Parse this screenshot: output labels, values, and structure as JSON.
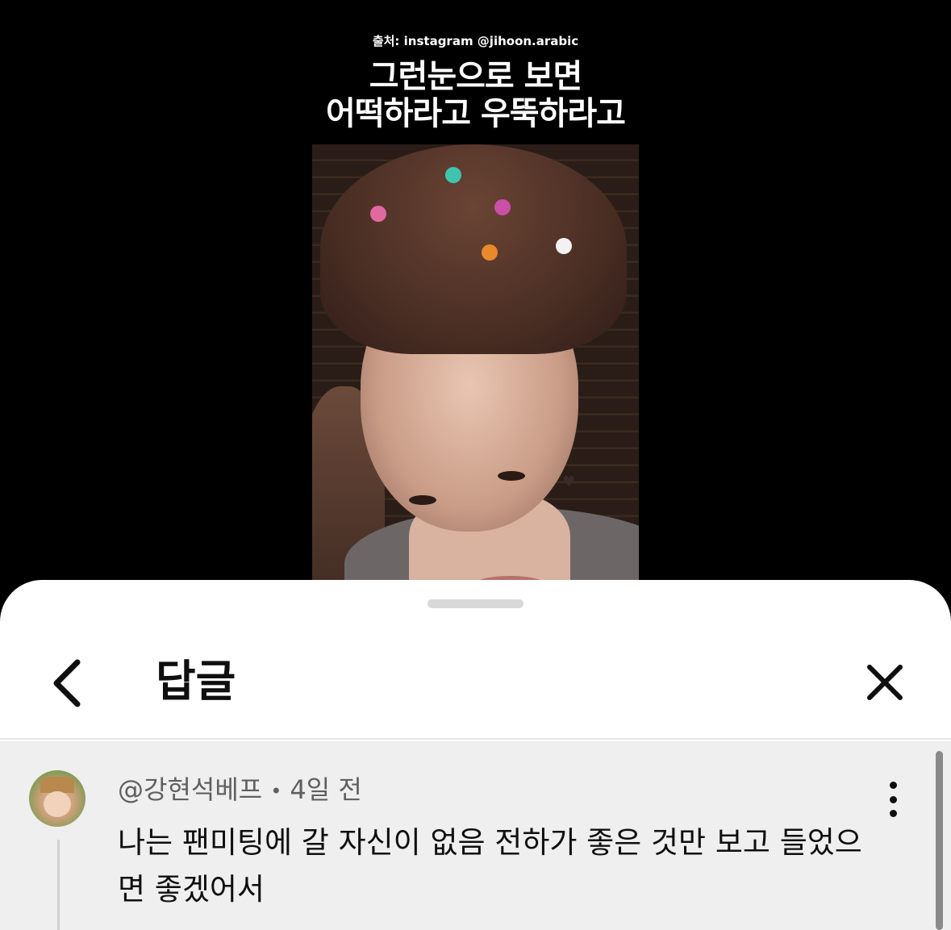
{
  "video": {
    "source_caption": "출처: instagram @jihoon.arabic",
    "title_line1": "그런눈으로 보면",
    "title_line2": "어떡하라고 우뚝하라고"
  },
  "sheet": {
    "title": "답글",
    "back_icon": "chevron-left-icon",
    "close_icon": "close-icon"
  },
  "comment": {
    "author": "@강현석베프",
    "separator": "•",
    "time": "4일 전",
    "text": "나는 팬미팅에 갈 자신이 없음 전하가 좋은 것만 보고 들었으면 좋겠어서",
    "more_icon": "more-vertical-icon"
  }
}
